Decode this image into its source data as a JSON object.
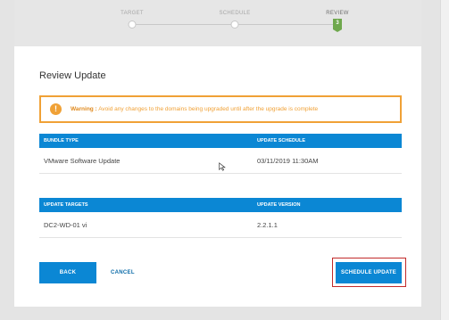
{
  "stepper": {
    "steps": [
      {
        "label": "TARGET"
      },
      {
        "label": "SCHEDULE"
      },
      {
        "label": "REVIEW",
        "badge": "3"
      }
    ]
  },
  "page": {
    "title": "Review Update"
  },
  "warning": {
    "icon": "warning-icon",
    "label": "Warning :",
    "message": "Avoid any changes to the domains being upgraded until after the upgrade is complete"
  },
  "bundle_table": {
    "headers": [
      "BUNDLE TYPE",
      "UPDATE SCHEDULE"
    ],
    "rows": [
      {
        "bundle_type": "VMware Software Update",
        "schedule": "03/11/2019 11:30AM"
      }
    ]
  },
  "targets_table": {
    "headers": [
      "UPDATE TARGETS",
      "UPDATE VERSION"
    ],
    "rows": [
      {
        "target": "DC2-WD-01",
        "suffix": "vi",
        "version": "2.2.1.1"
      }
    ]
  },
  "buttons": {
    "back": "BACK",
    "cancel": "CANCEL",
    "schedule": "SCHEDULE UPDATE"
  },
  "colors": {
    "accent": "#0b87d4",
    "warning": "#f0a136",
    "step_active": "#6fa84d",
    "highlight": "#c22a2a"
  }
}
